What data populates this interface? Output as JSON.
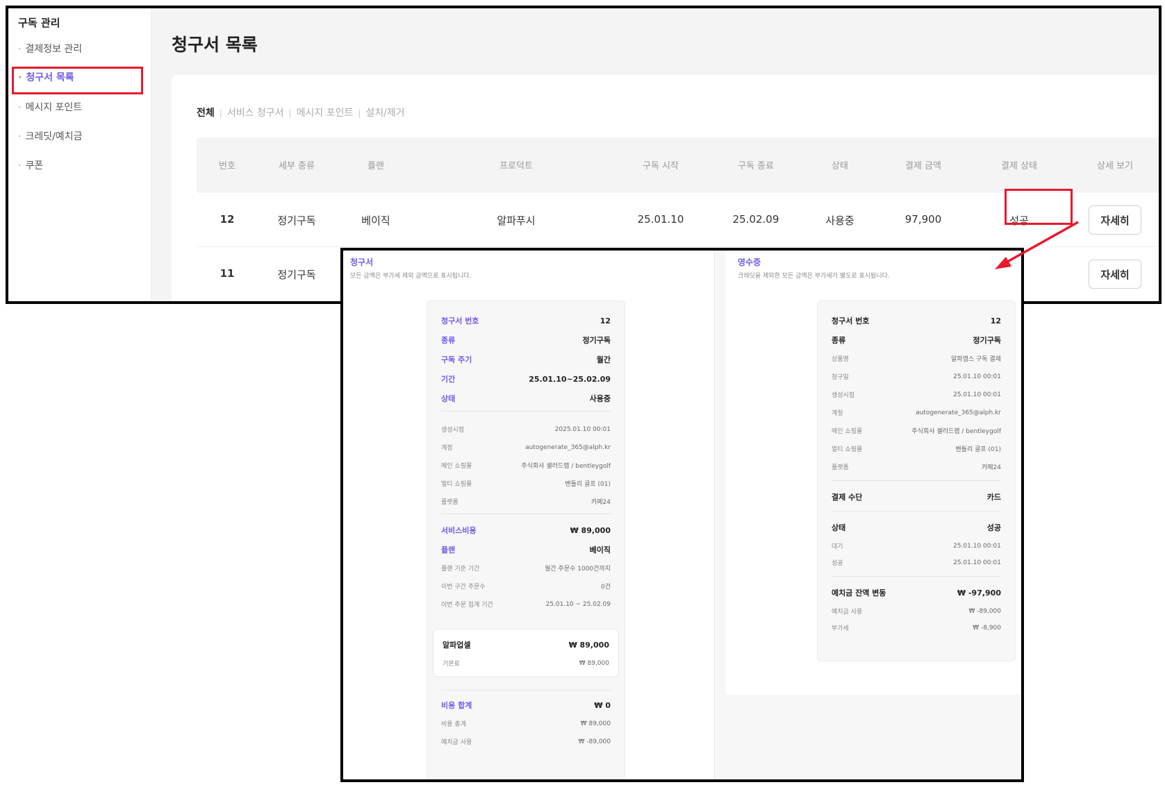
{
  "sidebar": {
    "title": "구독 관리",
    "items": [
      {
        "label": "결제정보 관리",
        "active": false
      },
      {
        "label": "청구서 목록",
        "active": true
      },
      {
        "label": "메시지 포인트",
        "active": false
      },
      {
        "label": "크레딧/예치금",
        "active": false
      },
      {
        "label": "쿠폰",
        "active": false
      }
    ]
  },
  "page": {
    "title": "청구서 목록"
  },
  "filter_tabs": [
    "전체",
    "서비스 청구서",
    "메시지 포인트",
    "설치/제거"
  ],
  "table": {
    "headers": [
      "번호",
      "세부 종류",
      "플랜",
      "프로덕트",
      "구독 시작",
      "구독 종료",
      "상태",
      "결제 금액",
      "결제 상태",
      "상세 보기"
    ],
    "rows": [
      {
        "no": "12",
        "kind": "정기구독",
        "plan": "베이직",
        "product": "알파푸시",
        "start": "25.01.10",
        "end": "25.02.09",
        "status": "사용중",
        "amount": "97,900",
        "pay_status": "성공",
        "detail": "자세히"
      },
      {
        "no": "11",
        "kind": "정기구독",
        "detail": "자세히"
      }
    ]
  },
  "invoice": {
    "title": "청구서",
    "subtitle": "모든 금액은 부가세 제외 금액으로 표시됩니다.",
    "summary": [
      {
        "k": "청구서 번호",
        "v": "12"
      },
      {
        "k": "종류",
        "v": "정기구독"
      },
      {
        "k": "구독 주기",
        "v": "월간"
      },
      {
        "k": "기간",
        "v": "25.01.10~25.02.09"
      },
      {
        "k": "상태",
        "v": "사용중"
      }
    ],
    "meta": [
      {
        "k": "생성시점",
        "v": "2025.01.10 00:01"
      },
      {
        "k": "계정",
        "v": "autogenerate_365@alph.kr"
      },
      {
        "k": "메인 쇼핑몰",
        "v": "주식회사 셀러드랩 / bentleygolf"
      },
      {
        "k": "멀티 쇼핑몰",
        "v": "벤틀리 골프 (01)"
      },
      {
        "k": "플랫폼",
        "v": "카페24"
      }
    ],
    "service_cost": {
      "k": "서비스비용",
      "v": "₩ 89,000"
    },
    "plan": {
      "k": "플랜",
      "v": "베이직"
    },
    "plan_meta": [
      {
        "k": "플랜 기준 기간",
        "v": "월간 주문수 1000건까지"
      },
      {
        "k": "이번 구간 주문수",
        "v": "0건"
      },
      {
        "k": "이번 주문 집계 기간",
        "v": "25.01.10 ~ 25.02.09"
      }
    ],
    "addon": {
      "name": {
        "k": "알파업셀",
        "v": "₩ 89,000"
      },
      "base": {
        "k": "기본료",
        "v": "₩ 89,000"
      }
    },
    "total": {
      "k": "비용 합계",
      "v": "₩ 0"
    },
    "total_meta": [
      {
        "k": "비용 총계",
        "v": "₩ 89,000"
      },
      {
        "k": "예치금 사용",
        "v": "₩ -89,000"
      }
    ]
  },
  "receipt": {
    "title": "영수증",
    "subtitle": "크레딧을 제외한 모든 금액은 부가세가 별도로 표시됩니다.",
    "head": [
      {
        "k": "청구서 번호",
        "v": "12"
      },
      {
        "k": "종류",
        "v": "정기구독"
      }
    ],
    "meta": [
      {
        "k": "상품명",
        "v": "알파앱스 구독 결제"
      },
      {
        "k": "청구일",
        "v": "25.01.10 00:01"
      },
      {
        "k": "생성시점",
        "v": "25.01.10 00:01"
      },
      {
        "k": "계정",
        "v": "autogenerate_365@alph.kr"
      },
      {
        "k": "메인 쇼핑몰",
        "v": "주식회사 셀러드랩 / bentleygolf"
      },
      {
        "k": "멀티 쇼핑몰",
        "v": "벤틀리 골프 (01)"
      },
      {
        "k": "플랫폼",
        "v": "카페24"
      }
    ],
    "payment_method": {
      "k": "결제 수단",
      "v": "카드"
    },
    "status": {
      "k": "상태",
      "v": "성공"
    },
    "status_meta": [
      {
        "k": "대기",
        "v": "25.01.10 00:01"
      },
      {
        "k": "성공",
        "v": "25.01.10 00:01"
      }
    ],
    "deposit": {
      "k": "예치금 잔액 변동",
      "v": "₩ -97,900"
    },
    "deposit_meta": [
      {
        "k": "예치금 사용",
        "v": "₩ -89,000"
      },
      {
        "k": "부가세",
        "v": "₩ -8,900"
      }
    ]
  },
  "colors": {
    "accent": "#6c5ce7",
    "highlight": "#e8192c"
  }
}
